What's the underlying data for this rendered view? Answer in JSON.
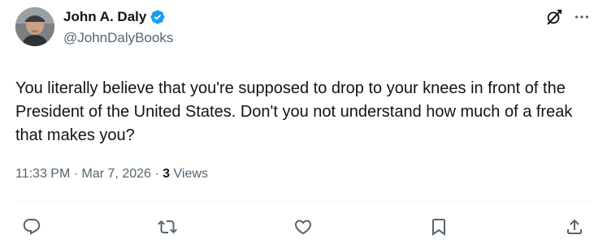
{
  "author": {
    "display_name": "John A. Daly",
    "handle": "@JohnDalyBooks",
    "verified": true
  },
  "tweet": {
    "text": "You literally believe that you're supposed to drop to your knees in front of the President of the United States. Don't you not understand how much of a freak that makes you?",
    "time": "11:33 PM",
    "date": "Mar 7, 2026",
    "views_count": "3",
    "views_label": "Views",
    "separator": "·"
  },
  "icons": {
    "top": [
      "grok-icon",
      "more-icon"
    ],
    "actions": [
      "reply-icon",
      "retweet-icon",
      "like-icon",
      "bookmark-icon",
      "share-icon"
    ]
  },
  "colors": {
    "text_primary": "#0f1419",
    "text_secondary": "#536471",
    "verified_blue": "#1d9bf0",
    "divider": "#eff3f4"
  }
}
